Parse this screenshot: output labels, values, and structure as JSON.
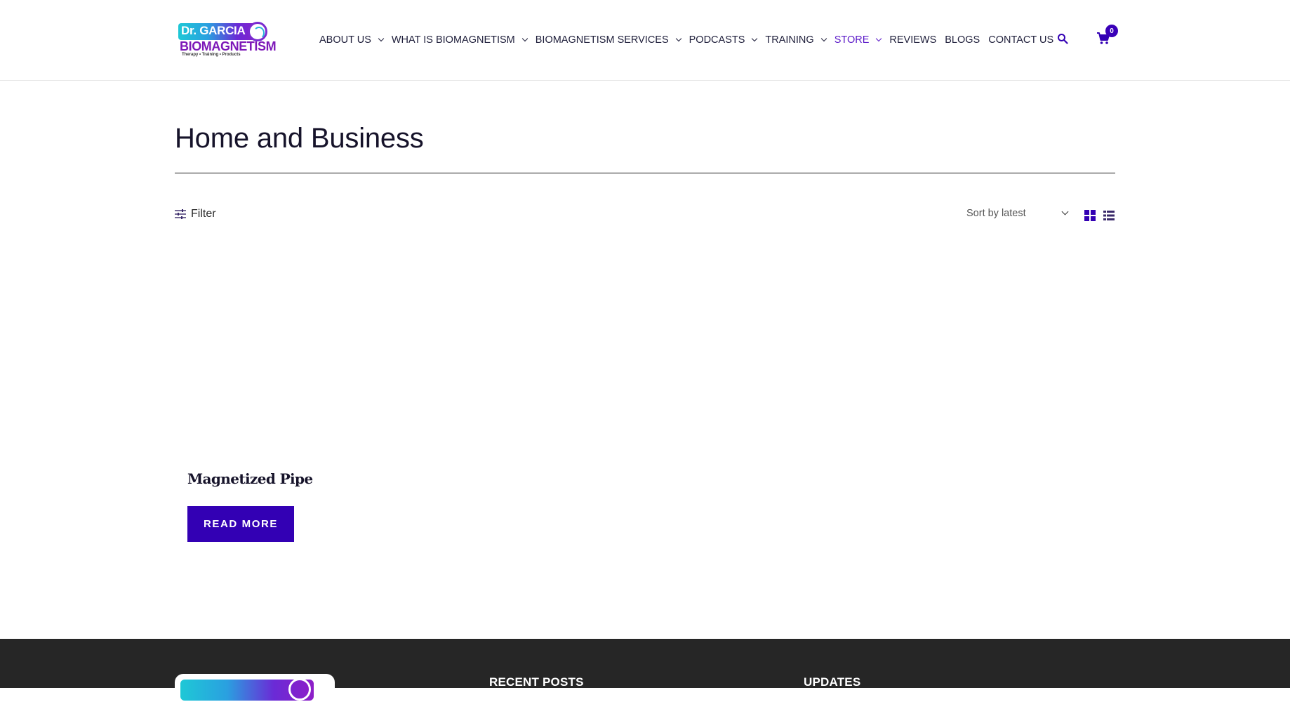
{
  "brand": {
    "logo_line1": "Dr. GARCIA",
    "logo_line2": "BIOMAGNETISM",
    "logo_tagline": "Therapy • Training • Products",
    "accent_color": "#3300b4",
    "active_nav_color": "#5a18c8"
  },
  "nav": {
    "items": [
      {
        "label": "ABOUT US",
        "has_dropdown": true
      },
      {
        "label": "WHAT IS BIOMAGNETISM",
        "has_dropdown": true
      },
      {
        "label": "BIOMAGNETISM SERVICES",
        "has_dropdown": true
      },
      {
        "label": "PODCASTS",
        "has_dropdown": true
      },
      {
        "label": "TRAINING",
        "has_dropdown": true
      },
      {
        "label": "STORE",
        "has_dropdown": true,
        "active": true
      },
      {
        "label": "REVIEWS",
        "has_dropdown": false
      },
      {
        "label": "BLOGS",
        "has_dropdown": false
      },
      {
        "label": "CONTACT US",
        "has_dropdown": false
      }
    ],
    "search_icon": "search-icon",
    "cart_icon": "cart-icon",
    "cart_count": "0"
  },
  "page": {
    "title": "Home and Business"
  },
  "toolbar": {
    "filter_label": "Filter",
    "sort_selected": "Sort by latest",
    "grid_view_icon": "grid-view-icon",
    "list_view_icon": "list-view-icon"
  },
  "products": [
    {
      "title": "Magnetized Pipe",
      "button_label": "READ MORE"
    }
  ],
  "footer": {
    "recent_posts_heading": "RECENT POSTS",
    "updates_heading": "UPDATES"
  }
}
